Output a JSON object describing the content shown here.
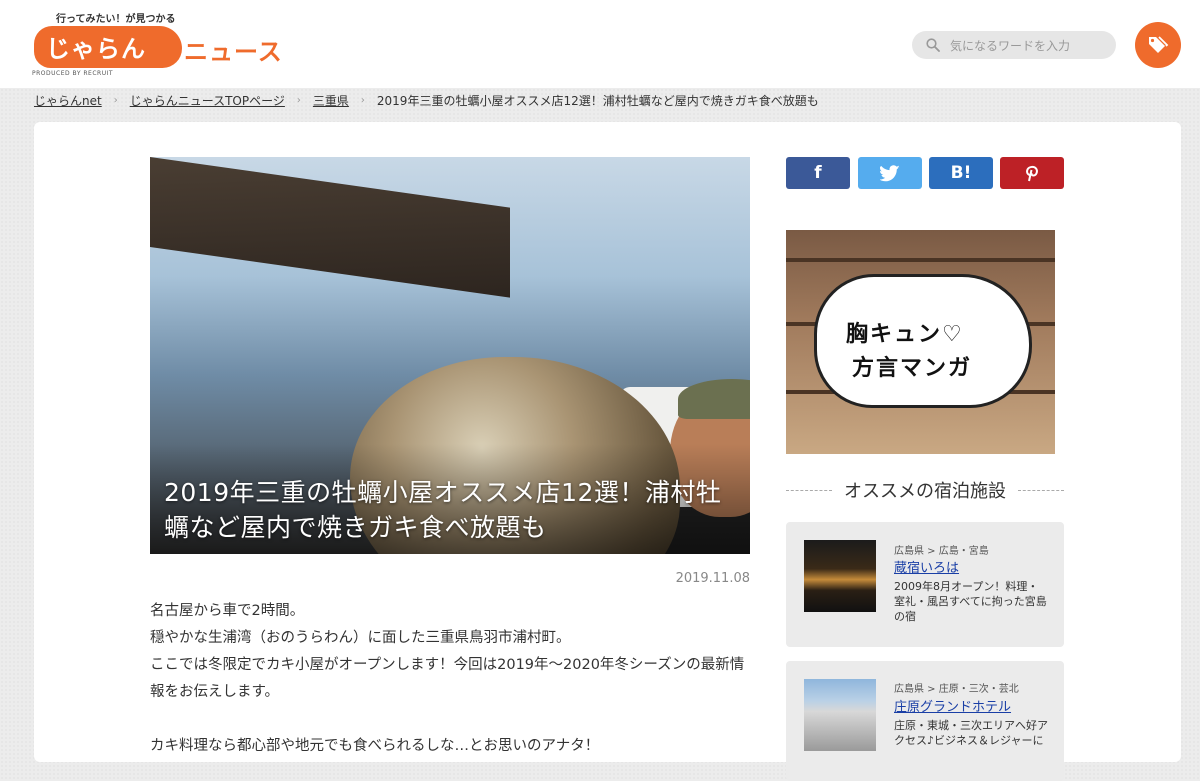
{
  "header": {
    "tagline": "行ってみたい！が見つかる",
    "logo_main": "じゃらん",
    "logo_sub": "ニュース",
    "produced_by": "PRODUCED BY RECRUIT",
    "search_placeholder": "気になるワードを入力"
  },
  "breadcrumb": [
    {
      "label": "じゃらんnet"
    },
    {
      "label": "じゃらんニュースTOPページ"
    },
    {
      "label": "三重県"
    },
    {
      "label": "2019年三重の牡蠣小屋オススメ店12選！浦村牡蠣など屋内で焼きガキ食べ放題も"
    }
  ],
  "article": {
    "title": "2019年三重の牡蠣小屋オススメ店12選！浦村牡蠣など屋内で焼きガキ食べ放題も",
    "date": "2019.11.08",
    "paragraphs": [
      "名古屋から車で2時間。",
      "穏やかな生浦湾（おのうらわん）に面した三重県鳥羽市浦村町。",
      "ここでは冬限定でカキ小屋がオープンします！今回は2019年～2020年冬シーズンの最新情報をお伝えします。",
      "カキ料理なら都心部や地元でも食べられるしな…とお思いのアナタ！"
    ]
  },
  "share": {
    "facebook": "f",
    "hatena": "B!"
  },
  "banner": {
    "line1": "胸キュン♡",
    "line2": "方言マンガ"
  },
  "sidebar": {
    "section_title": "オススメの宿泊施設",
    "hotels": [
      {
        "area": "広島県 > 広島・宮島",
        "name": "蔵宿いろは",
        "desc": "2009年8月オープン！料理・室礼・風呂すべてに拘った宮島の宿"
      },
      {
        "area": "広島県 > 庄原・三次・芸北",
        "name": "庄原グランドホテル",
        "desc": "庄原・東城・三次エリアへ好アクセス♪ビジネス＆レジャーに"
      }
    ]
  },
  "colors": {
    "brand": "#ef6b2c",
    "facebook": "#3b5998",
    "twitter": "#55acee",
    "hatena": "#2c6ebd",
    "pinterest": "#bd2126"
  }
}
